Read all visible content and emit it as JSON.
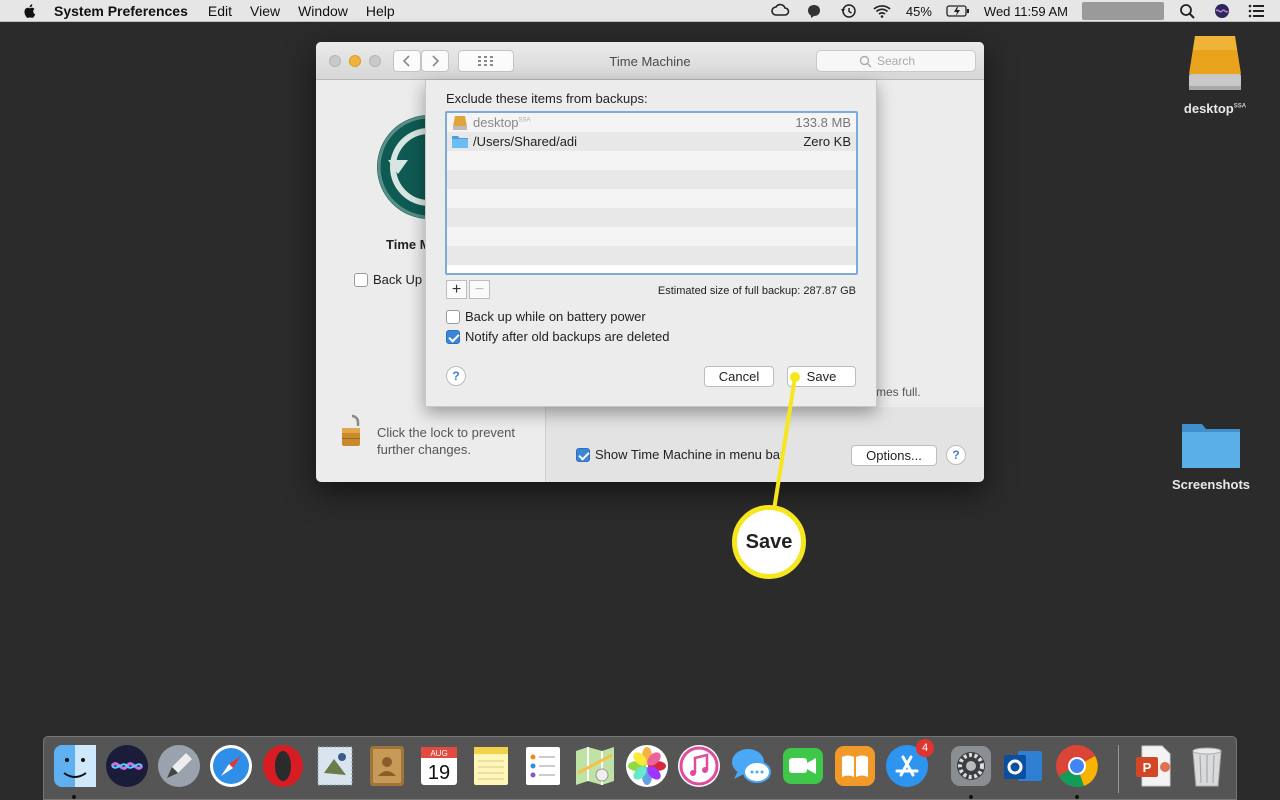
{
  "menubar": {
    "app_name": "System Preferences",
    "items": [
      "Edit",
      "View",
      "Window",
      "Help"
    ],
    "battery": "45%",
    "clock": "Wed 11:59 AM"
  },
  "desktop": {
    "drive_label": "desktop",
    "drive_superscript": "SSA",
    "folder_label": "Screenshots"
  },
  "window": {
    "title": "Time Machine",
    "search_placeholder": "Search",
    "app_label": "Time M",
    "backup_auto_label": "Back Up",
    "full_note": "mes full.",
    "lock_text": "Click the lock to prevent further changes.",
    "show_menu_label": "Show Time Machine in menu bar",
    "show_menu_checked": true,
    "options_label": "Options...",
    "help_label": "?"
  },
  "sheet": {
    "title": "Exclude these items from backups:",
    "items": [
      {
        "name": "desktop",
        "superscript": "SSA",
        "size": "133.8 MB",
        "icon": "drive-icon"
      },
      {
        "name": "/Users/Shared/adi",
        "size": "Zero KB",
        "icon": "folder-icon"
      }
    ],
    "add_label": "+",
    "remove_label": "−",
    "estimate": "Estimated size of full backup: 287.87 GB",
    "battery_option": "Back up while on battery power",
    "battery_checked": false,
    "notify_option": "Notify after old backups are deleted",
    "notify_checked": true,
    "help_label": "?",
    "cancel_label": "Cancel",
    "save_label": "Save"
  },
  "callout": {
    "label": "Save",
    "color": "#f5e61e"
  },
  "dock": {
    "apps": [
      "Finder",
      "Siri",
      "Launchpad",
      "Safari",
      "Opera",
      "Mail",
      "Contacts",
      "Calendar",
      "Notes",
      "Reminders",
      "Maps",
      "Photos",
      "iTunes",
      "Messages",
      "FaceTime",
      "iBooks",
      "App Store",
      "System Preferences",
      "Outlook",
      "Chrome",
      "PowerPoint",
      "Trash"
    ],
    "calendar_month": "AUG",
    "calendar_day": "19",
    "appstore_badge": "4"
  }
}
